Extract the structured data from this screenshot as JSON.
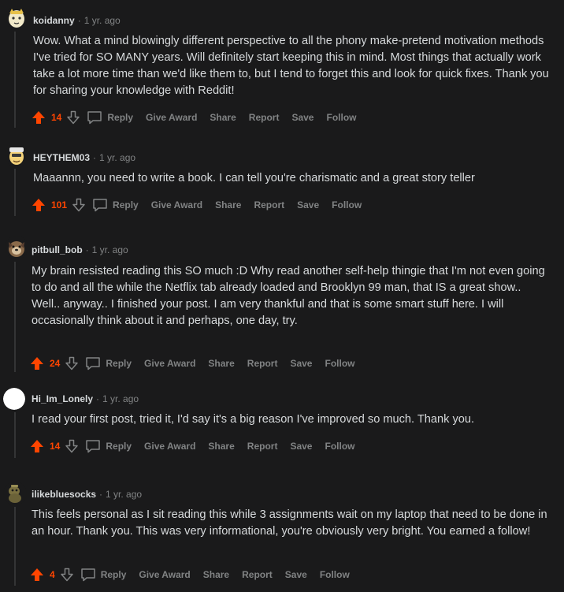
{
  "colors": {
    "upvote": "#ff4500",
    "muted": "#818384",
    "text": "#d7dadc",
    "background": "#1a1a1b"
  },
  "icons": {
    "upvote": "arrow-up-icon",
    "downvote": "arrow-down-icon",
    "reply": "speech-bubble-icon"
  },
  "actions": {
    "reply": "Reply",
    "give_award": "Give Award",
    "share": "Share",
    "report": "Report",
    "save": "Save",
    "follow": "Follow"
  },
  "separator": "·",
  "comments": [
    {
      "author": "koidanny",
      "age": "1 yr. ago",
      "votes": "14",
      "paragraphs": [
        "Wow. What a mind blowingly different perspective to all the phony make-pretend motivation methods I've tried for SO MANY years. Will definitely start keeping this in mind. Most things that actually work take a lot more time than we'd like them to, but I tend to forget this and look for quick fixes. Thank you for sharing your knowledge with Reddit!"
      ]
    },
    {
      "author": "HEYTHEM03",
      "age": "1 yr. ago",
      "votes": "101",
      "paragraphs": [
        "Maaannn, you need to write a book. I can tell you're charismatic and a great story teller"
      ]
    },
    {
      "author": "pitbull_bob",
      "age": "1 yr. ago",
      "votes": "24",
      "paragraphs": [
        "My brain resisted reading this SO much :D Why read another self-help thingie that I'm not even going to do and all the while the Netflix tab already loaded and Brooklyn 99 man, that IS a great show..",
        "Well.. anyway.. I finished your post. I am very thankful and that is some smart stuff here. I will occasionally think about it and perhaps, one day, try."
      ]
    },
    {
      "author": "Hi_Im_Lonely",
      "age": "1 yr. ago",
      "votes": "14",
      "paragraphs": [
        "I read your first post, tried it, I'd say it's a big reason I've improved so much. Thank you."
      ]
    },
    {
      "author": "ilikebluesocks",
      "age": "1 yr. ago",
      "votes": "4",
      "paragraphs": [
        "This feels personal as I sit reading this while 3 assignments wait on my laptop that need to be done in an hour. Thank you. This was very informational, you're obviously very bright. You earned a follow!"
      ]
    }
  ]
}
